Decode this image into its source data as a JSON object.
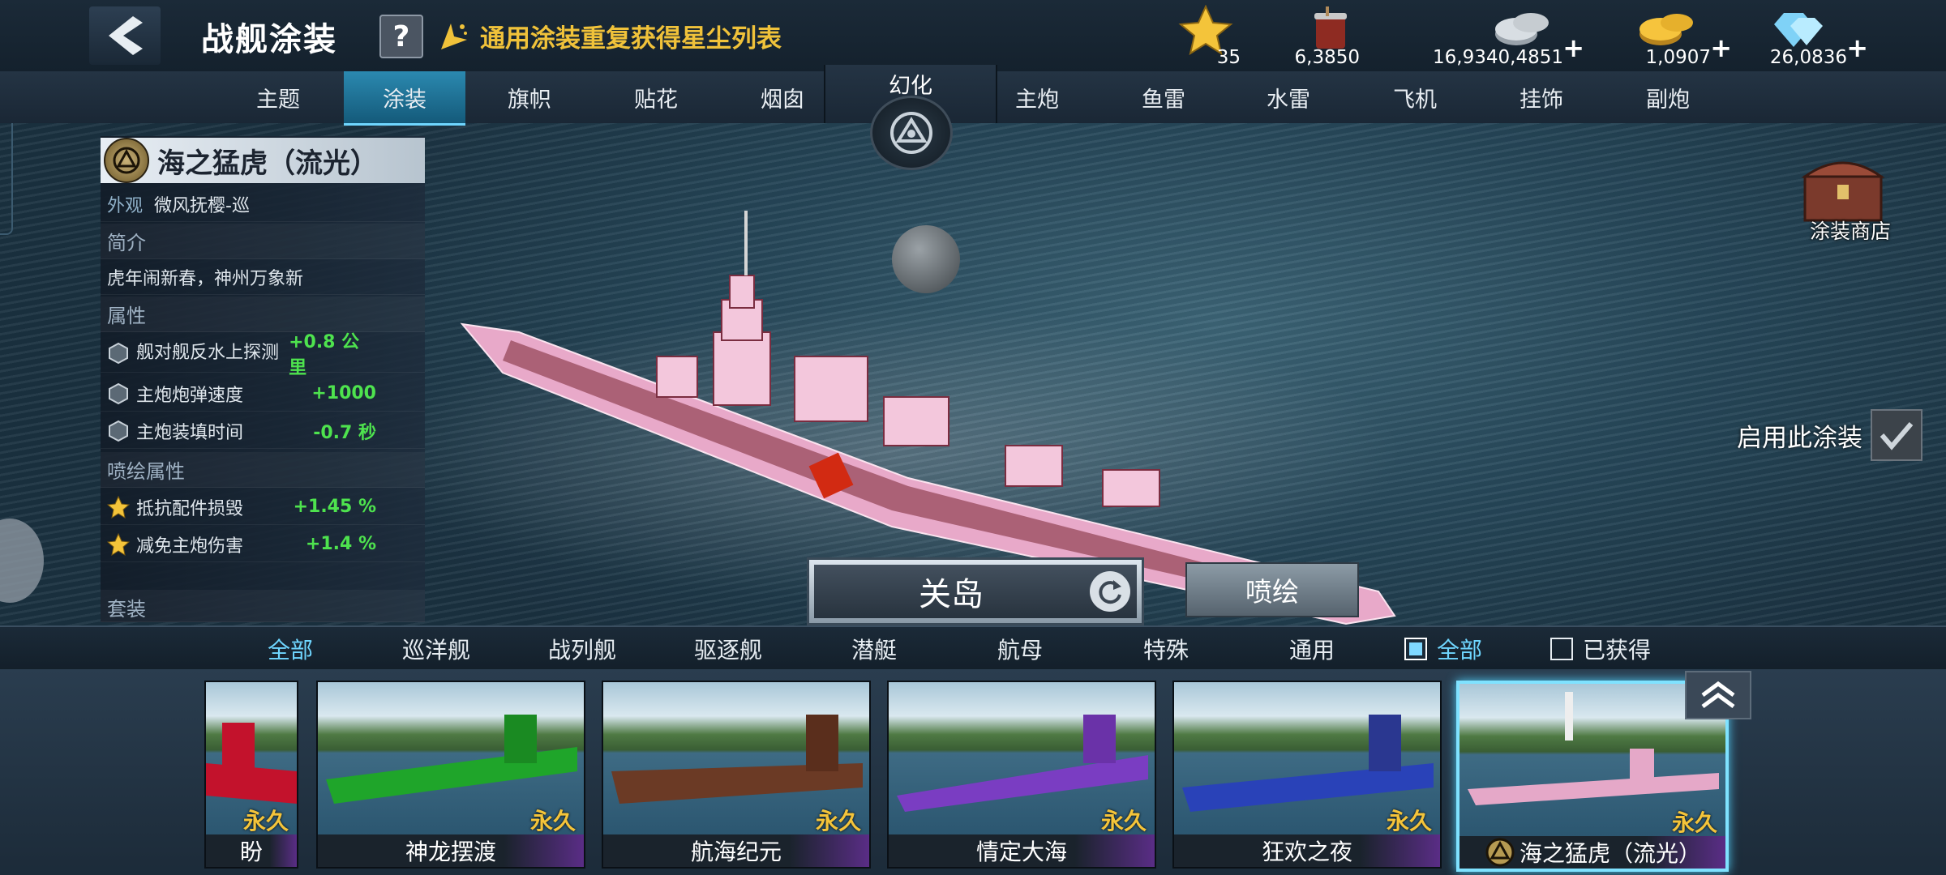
{
  "header": {
    "title": "战舰涂装",
    "help_label": "?",
    "stardust_link": "通用涂装重复获得星尘列表"
  },
  "resources": [
    {
      "icon": "star-icon",
      "value": "35"
    },
    {
      "icon": "paint-bucket-icon",
      "value": "6,3850"
    },
    {
      "icon": "silver-coin-icon",
      "value": "16,9340,4851",
      "plus": "+"
    },
    {
      "icon": "gold-coin-icon",
      "value": "1,0907",
      "plus": "+"
    },
    {
      "icon": "diamond-icon",
      "value": "26,0836",
      "plus": "+"
    }
  ],
  "tabs_left": [
    "主题",
    "涂装",
    "旗帜",
    "贴花",
    "烟囱"
  ],
  "tabs_active": "涂装",
  "transform_tab": "幻化",
  "tabs_right": [
    "主炮",
    "鱼雷",
    "水雷",
    "飞机",
    "挂饰",
    "副炮"
  ],
  "info": {
    "name": "海之猛虎（流光）",
    "appearance_key": "外观",
    "appearance_value": "微风抚樱-巡",
    "intro_head": "简介",
    "intro_text": "虎年闹新春，神州万象新",
    "attr_head": "属性",
    "attrs": [
      {
        "label": "舰对舰反水上探测",
        "value": "+0.8 公里"
      },
      {
        "label": "主炮炮弹速度",
        "value": "+1000"
      },
      {
        "label": "主炮装填时间",
        "value": "-0.7 秒"
      }
    ],
    "paint_attr_head": "喷绘属性",
    "paint_attrs": [
      {
        "label": "抵抗配件损毁",
        "value": "+1.45 %"
      },
      {
        "label": "减免主炮伤害",
        "value": "+1.4 %"
      }
    ],
    "more_head": "套装"
  },
  "shop_label": "涂装商店",
  "enable_label": "启用此涂装",
  "ship_name": "关岛",
  "paint_button": "喷绘",
  "filters": {
    "categories": [
      "全部",
      "巡洋舰",
      "战列舰",
      "驱逐舰",
      "潜艇",
      "航母",
      "特殊",
      "通用"
    ],
    "active": "全部",
    "checkbox_all": "全部",
    "checkbox_obtained": "已获得"
  },
  "cards": [
    {
      "name": "盼",
      "tag": "永久",
      "hull": "#c3122c"
    },
    {
      "name": "神龙摆渡",
      "tag": "永久",
      "hull": "#1fa52a"
    },
    {
      "name": "航海纪元",
      "tag": "永久",
      "hull": "#6b3a25"
    },
    {
      "name": "情定大海",
      "tag": "永久",
      "hull": "#7a3dc2"
    },
    {
      "name": "狂欢之夜",
      "tag": "永久",
      "hull": "#2942b8"
    },
    {
      "name": "海之猛虎（流光）",
      "tag": "永久",
      "hull": "#e5a8c8"
    }
  ],
  "colors": {
    "accent": "#6fd6ff",
    "positive": "#4ee34e",
    "gold": "#f4c43a",
    "ship_hull": "#e8a9c9"
  }
}
